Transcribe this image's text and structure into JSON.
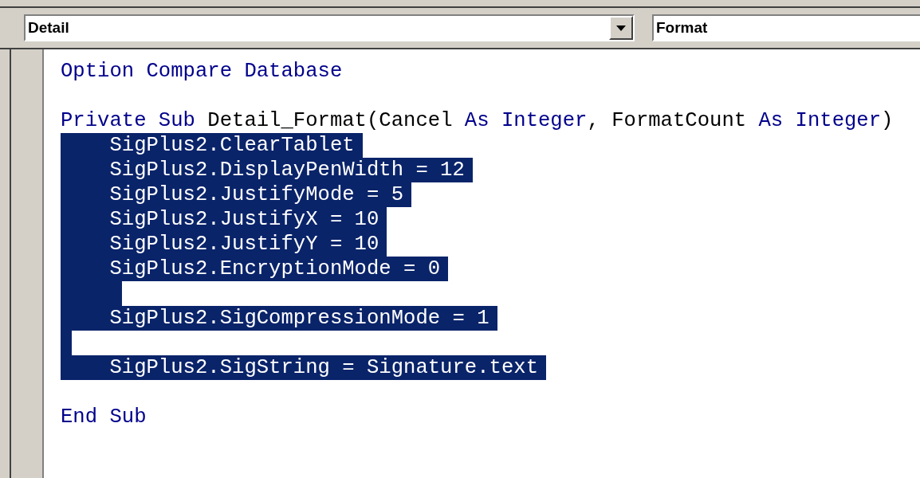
{
  "object_combo": {
    "value": "Detail"
  },
  "procedure_combo": {
    "value": "Format"
  },
  "code_lines": [
    {
      "selected": false,
      "tokens": [
        {
          "kind": "keyword",
          "text": "Option Compare Database"
        }
      ]
    },
    {
      "selected": false
    },
    {
      "selected": false,
      "tokens": [
        {
          "kind": "keyword",
          "text": "Private Sub"
        },
        {
          "kind": "plain",
          "text": " Detail_Format(Cancel "
        },
        {
          "kind": "keyword",
          "text": "As Integer"
        },
        {
          "kind": "plain",
          "text": ", FormatCount "
        },
        {
          "kind": "keyword",
          "text": "As Integer"
        },
        {
          "kind": "plain",
          "text": ")"
        }
      ]
    },
    {
      "selected": true,
      "tokens": [
        {
          "kind": "plain",
          "text": "    SigPlus2.ClearTablet"
        }
      ]
    },
    {
      "selected": true,
      "tokens": [
        {
          "kind": "plain",
          "text": "    SigPlus2.DisplayPenWidth = 12"
        }
      ]
    },
    {
      "selected": true,
      "tokens": [
        {
          "kind": "plain",
          "text": "    SigPlus2.JustifyMode = 5"
        }
      ]
    },
    {
      "selected": true,
      "tokens": [
        {
          "kind": "plain",
          "text": "    SigPlus2.JustifyX = 10"
        }
      ]
    },
    {
      "selected": true,
      "tokens": [
        {
          "kind": "plain",
          "text": "    SigPlus2.JustifyY = 10"
        }
      ]
    },
    {
      "selected": true,
      "tokens": [
        {
          "kind": "plain",
          "text": "    SigPlus2.EncryptionMode = 0"
        }
      ]
    },
    {
      "selected": true,
      "kind": "indented"
    },
    {
      "selected": true,
      "tokens": [
        {
          "kind": "plain",
          "text": "    SigPlus2.SigCompressionMode = 1"
        }
      ]
    },
    {
      "selected": true,
      "kind": "blank"
    },
    {
      "selected": true,
      "tokens": [
        {
          "kind": "plain",
          "text": "    SigPlus2.SigString = Signature.text"
        }
      ]
    },
    {
      "selected": false
    },
    {
      "selected": false,
      "tokens": [
        {
          "kind": "keyword",
          "text": "End Sub"
        }
      ]
    }
  ]
}
